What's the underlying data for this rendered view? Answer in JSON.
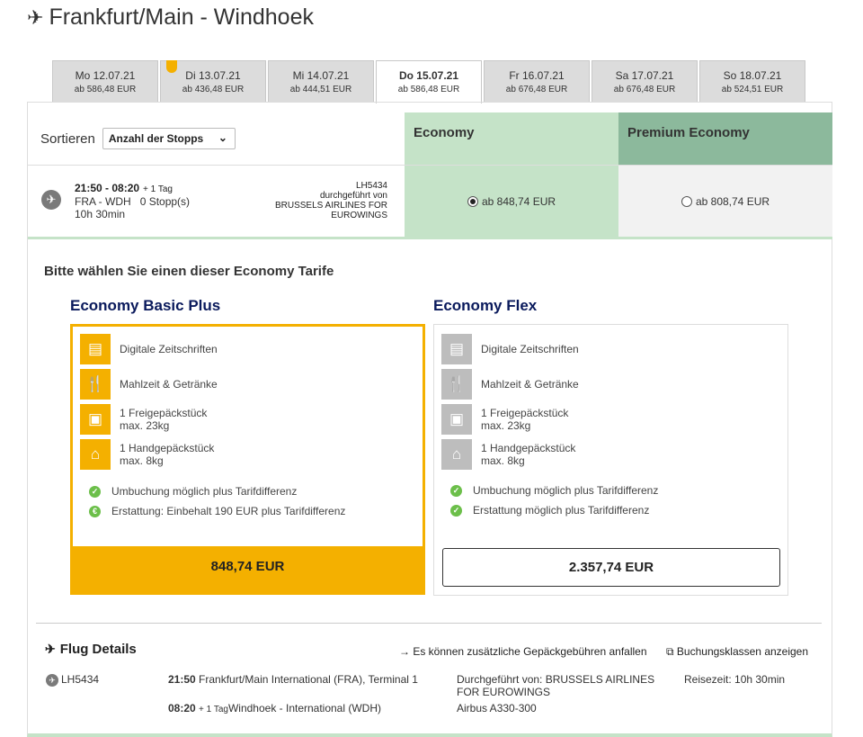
{
  "route": {
    "title": "Frankfurt/Main - Windhoek"
  },
  "dates": [
    {
      "day": "Mo 12.07.21",
      "price": "ab 586,48 EUR"
    },
    {
      "day": "Di 13.07.21",
      "price": "ab 436,48 EUR"
    },
    {
      "day": "Mi 14.07.21",
      "price": "ab 444,51 EUR"
    },
    {
      "day": "Do 15.07.21",
      "price": "ab 586,48 EUR"
    },
    {
      "day": "Fr 16.07.21",
      "price": "ab 676,48 EUR"
    },
    {
      "day": "Sa 17.07.21",
      "price": "ab 676,48 EUR"
    },
    {
      "day": "So 18.07.21",
      "price": "ab 524,51 EUR"
    }
  ],
  "sort": {
    "label": "Sortieren",
    "value": "Anzahl der Stopps"
  },
  "cabins": {
    "economy": "Economy",
    "premium": "Premium Economy"
  },
  "flight": {
    "times": "21:50 - 08:20",
    "plus_day": "+ 1 Tag",
    "route": "FRA - WDH",
    "stops": "0 Stopp(s)",
    "duration": "10h 30min",
    "number": "LH5434",
    "operated_label": "durchgeführt von",
    "operator": "BRUSSELS AIRLINES FOR EUROWINGS",
    "economy_price": "ab 848,74 EUR",
    "premium_price": "ab 808,74 EUR"
  },
  "tarif": {
    "title": "Bitte wählen Sie einen dieser Economy Tarife",
    "basic": {
      "name": "Economy Basic Plus",
      "features": [
        {
          "icon": "newspaper-icon",
          "line1": "Digitale Zeitschriften",
          "line2": ""
        },
        {
          "icon": "cutlery-icon",
          "line1": "Mahlzeit & Getränke",
          "line2": ""
        },
        {
          "icon": "suitcase-icon",
          "line1": "1 Freigepäckstück",
          "line2": "max. 23kg"
        },
        {
          "icon": "handbag-icon",
          "line1": "1 Handgepäckstück",
          "line2": "max. 8kg"
        }
      ],
      "conditions": [
        {
          "icon": "check-icon",
          "text": "Umbuchung möglich plus Tarifdifferenz"
        },
        {
          "icon": "euro-icon",
          "text": "Erstattung: Einbehalt 190 EUR plus Tarifdifferenz"
        }
      ],
      "price": "848,74 EUR"
    },
    "flex": {
      "name": "Economy Flex",
      "features": [
        {
          "icon": "newspaper-icon",
          "line1": "Digitale Zeitschriften",
          "line2": ""
        },
        {
          "icon": "cutlery-icon",
          "line1": "Mahlzeit & Getränke",
          "line2": ""
        },
        {
          "icon": "suitcase-icon",
          "line1": "1 Freigepäckstück",
          "line2": "max. 23kg"
        },
        {
          "icon": "handbag-icon",
          "line1": "1 Handgepäckstück",
          "line2": "max. 8kg"
        }
      ],
      "conditions": [
        {
          "icon": "check-icon",
          "text": "Umbuchung möglich plus Tarifdifferenz"
        },
        {
          "icon": "check-icon",
          "text": "Erstattung möglich plus Tarifdifferenz"
        }
      ],
      "price": "2.357,74 EUR"
    }
  },
  "details": {
    "title": "Flug Details",
    "baggage_link": "Es können zusätzliche Gepäckgebühren anfallen",
    "classes_link": "Buchungsklassen anzeigen",
    "flight_number": "LH5434",
    "dep_time": "21:50",
    "dep_place": "Frankfurt/Main International (FRA), Terminal 1",
    "arr_time": "08:20",
    "arr_plus": "+ 1 Tag",
    "arr_place": "Windhoek - International (WDH)",
    "operated": "Durchgeführt von: BRUSSELS AIRLINES FOR EUROWINGS",
    "aircraft": "Airbus A330-300",
    "travel_time": "Reisezeit: 10h 30min"
  },
  "colors": {
    "accent": "#f4b000",
    "economy": "#c5e3c8",
    "premium": "#8cb99c",
    "brand_navy": "#0a1a5c"
  }
}
